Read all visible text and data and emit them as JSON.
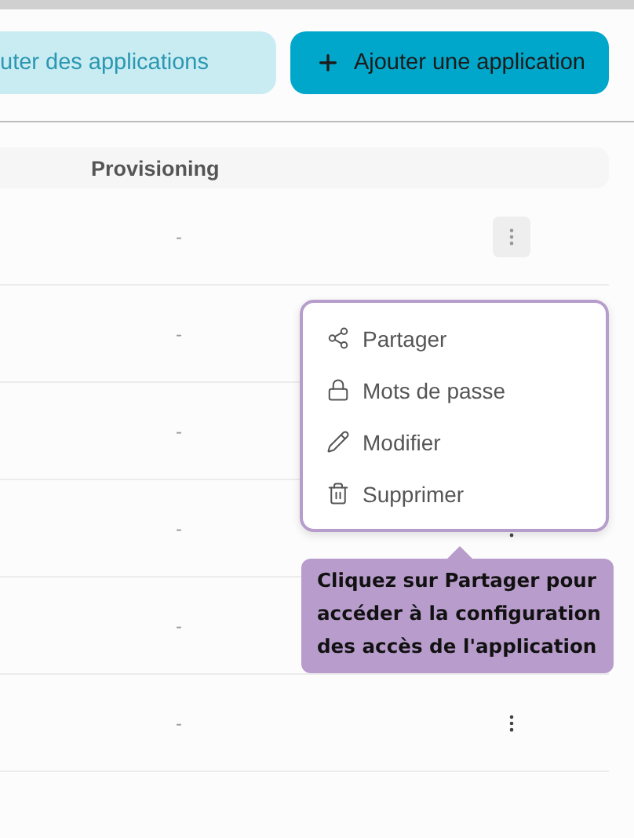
{
  "toolbar": {
    "buttons": [
      {
        "kind": "secondary",
        "label": "uter des applications"
      },
      {
        "kind": "primary",
        "label": "Ajouter une application"
      }
    ]
  },
  "table": {
    "columns": [
      "Provisioning"
    ],
    "rows": [
      {
        "provisioning": "-"
      },
      {
        "provisioning": "-"
      },
      {
        "provisioning": "-"
      },
      {
        "provisioning": "-"
      },
      {
        "provisioning": "-"
      },
      {
        "provisioning": "-"
      }
    ]
  },
  "context_menu": {
    "open": true,
    "items": [
      {
        "label": "Partager"
      },
      {
        "label": "Mots de passe"
      },
      {
        "label": "Modifier"
      },
      {
        "label": "Supprimer"
      }
    ]
  },
  "tooltip": {
    "text": "Cliquez sur Partager pour accéder à la configuration des accès de l'application"
  }
}
